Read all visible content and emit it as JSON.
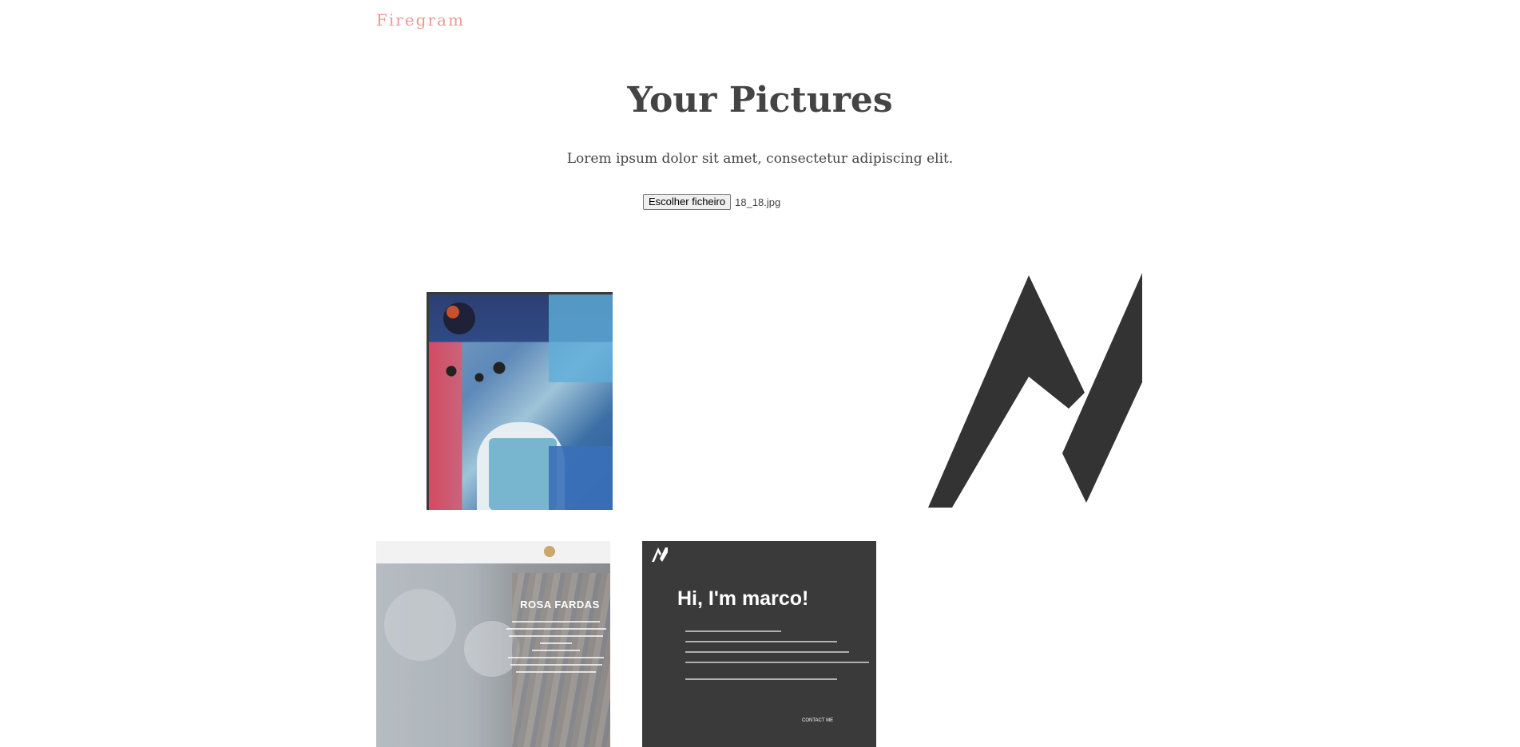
{
  "brand": {
    "label": "Firegram",
    "color": "#e89a92"
  },
  "hero": {
    "title": "Your Pictures",
    "subtitle": "Lorem ipsum dolor sit amet, consectetur adipiscing elit."
  },
  "upload": {
    "button_label": "Escolher ficheiro",
    "file_name": "18_18.jpg"
  },
  "gallery": {
    "rosa": {
      "heading": "ROSA FARDAS"
    },
    "marco": {
      "heading": "Hi, I'm marco!",
      "button": "CONTACT ME"
    }
  }
}
